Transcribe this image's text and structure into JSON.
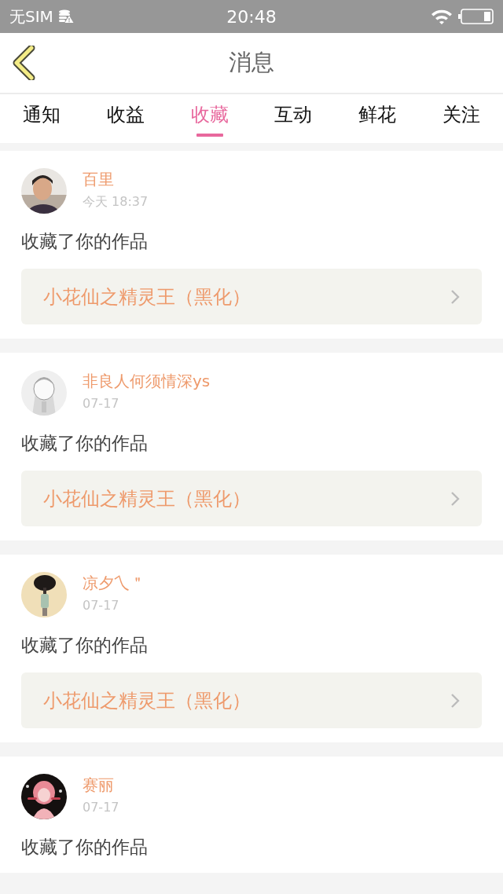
{
  "status_bar": {
    "carrier": "无SIM",
    "time": "20:48"
  },
  "header": {
    "title": "消息"
  },
  "tabs": [
    {
      "label": "通知",
      "selected": false
    },
    {
      "label": "收益",
      "selected": false
    },
    {
      "label": "收藏",
      "selected": true
    },
    {
      "label": "互动",
      "selected": false
    },
    {
      "label": "鲜花",
      "selected": false
    },
    {
      "label": "关注",
      "selected": false
    }
  ],
  "messages": [
    {
      "name": "百里",
      "time": "今天 18:37",
      "text": "收藏了你的作品",
      "work": "小花仙之精灵王（黑化）"
    },
    {
      "name": "非良人何须情深ys",
      "time": "07-17",
      "text": "收藏了你的作品",
      "work": "小花仙之精灵王（黑化）"
    },
    {
      "name": "凉夕乀＂",
      "time": "07-17",
      "text": "收藏了你的作品",
      "work": "小花仙之精灵王（黑化）"
    },
    {
      "name": "赛丽",
      "time": "07-17",
      "text": "收藏了你的作品"
    }
  ]
}
